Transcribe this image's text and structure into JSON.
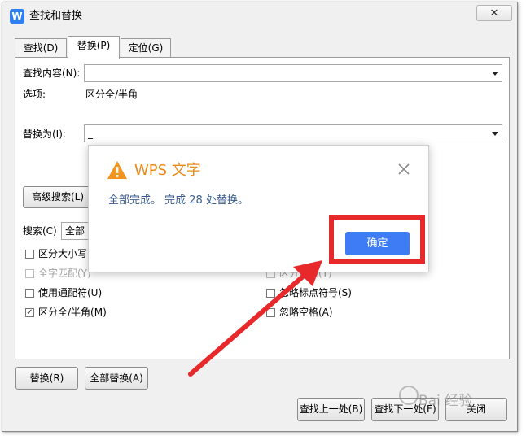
{
  "window": {
    "app_icon": "W",
    "title": "查找和替换",
    "close": "✕"
  },
  "tabs": [
    {
      "label": "查找(D)"
    },
    {
      "label": "替换(P)"
    },
    {
      "label": "定位(G)"
    }
  ],
  "find": {
    "label": "查找内容(N):",
    "value": ""
  },
  "options": {
    "label": "选项:",
    "value": "区分全/半角"
  },
  "replace": {
    "label": "替换为(I):",
    "value": "_"
  },
  "advanced_button": "高级搜索(L)",
  "search": {
    "label": "搜索(C)",
    "value": "全部"
  },
  "checkboxes": {
    "case": {
      "label": "区分大小写(",
      "checked": false
    },
    "whole_word": {
      "label": "全字匹配(Y)",
      "checked": false
    },
    "wildcard": {
      "label": "使用通配符(U)",
      "checked": false
    },
    "width": {
      "label": "区分全/半角(M)",
      "checked": true
    },
    "right_partial": {
      "label": "区分后缀(T)",
      "checked": false
    },
    "punct": {
      "label": "忽略标点符号(S)",
      "checked": false
    },
    "space": {
      "label": "忽略空格(A)",
      "checked": false
    }
  },
  "buttons": {
    "replace": "替换(R)",
    "replace_all": "全部替换(A)",
    "find_prev": "查找上一处(B)",
    "find_next": "查找下一处(F)",
    "close": "关闭"
  },
  "popup": {
    "title": "WPS 文字",
    "message": "全部完成。 完成 28 处替换。",
    "ok": "确定",
    "accent": "#e88a19",
    "ok_color": "#3d7cf5"
  },
  "highlight_color": "#e8292b",
  "watermark": "Bai 经验"
}
